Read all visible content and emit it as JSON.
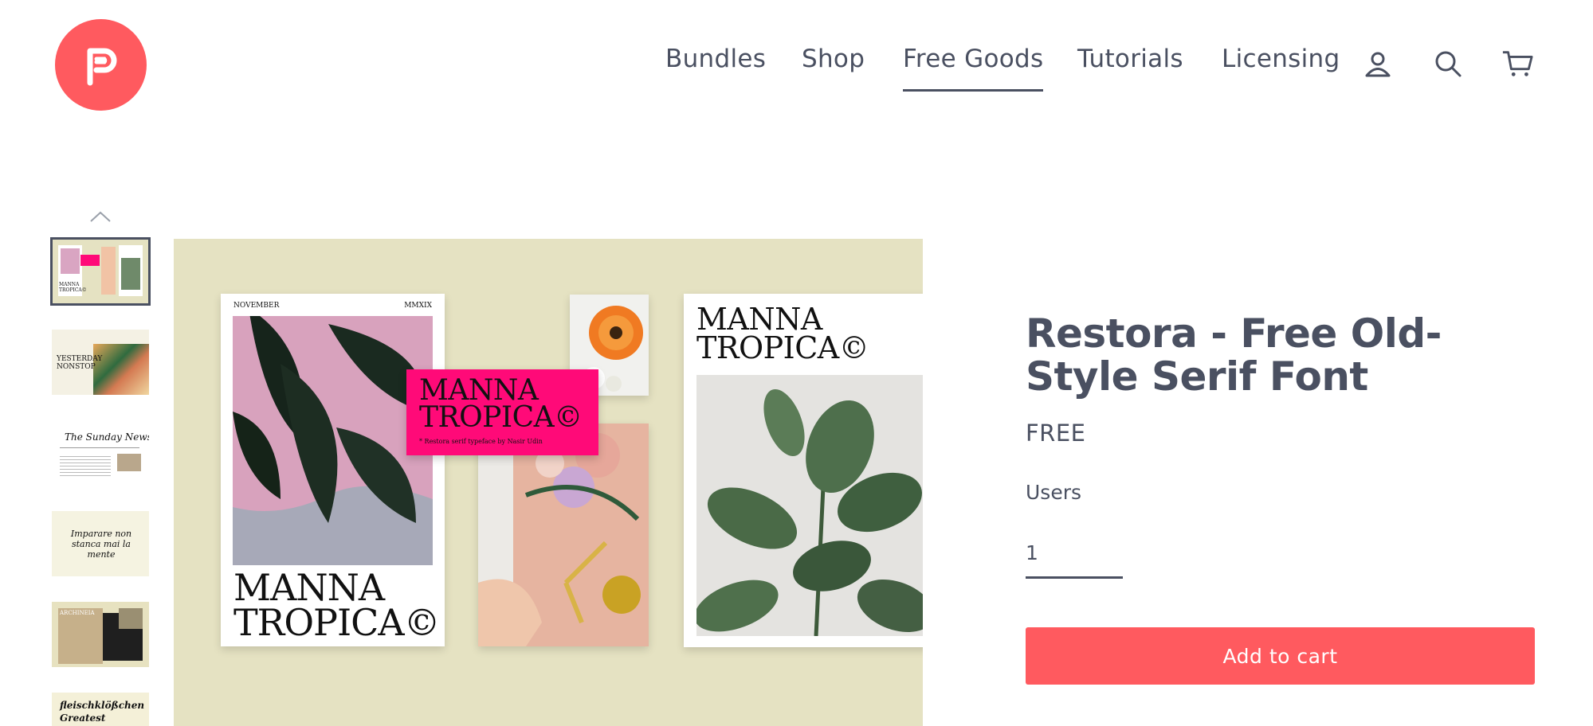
{
  "header": {
    "logo_icon": "brand-p-logo",
    "nav": [
      {
        "label": "Bundles",
        "active": false
      },
      {
        "label": "Shop",
        "active": false
      },
      {
        "label": "Free Goods",
        "active": true
      },
      {
        "label": "Tutorials",
        "active": false
      },
      {
        "label": "Licensing",
        "active": false
      }
    ],
    "icons": [
      "account-icon",
      "search-icon",
      "cart-icon"
    ]
  },
  "gallery": {
    "up_icon": "chevron-up-icon",
    "main_image": {
      "left_poster": {
        "month": "NOVEMBER",
        "year": "MMXIX",
        "title_line1": "MANNA",
        "title_line2": "TROPICA©"
      },
      "pink_card": {
        "title_line1": "MANNA",
        "title_line2": "TROPICA©",
        "caption": "* Restora serif typeface by Nasir Udin"
      },
      "right_poster": {
        "title_line1": "MANNA",
        "title_line2": "TROPICA©"
      }
    },
    "thumbs": [
      {
        "caption": "MANNA TROPICA©"
      },
      {
        "caption": "YESTERDAY NONSTOP"
      },
      {
        "caption": "The Sunday News"
      },
      {
        "caption": "Imparare non stanca mai la mente"
      },
      {
        "caption": "ARCHINEIA"
      },
      {
        "caption": "fleischklößchen Greatest"
      }
    ]
  },
  "product": {
    "title": "Restora - Free Old-Style Serif Font",
    "price": "FREE",
    "users_label": "Users",
    "quantity": "1",
    "add_to_cart": "Add to cart"
  },
  "colors": {
    "accent": "#ff5a5f",
    "text": "#4a5061",
    "image_background": "#e5e2c2",
    "pink_card": "#ff0a78"
  }
}
